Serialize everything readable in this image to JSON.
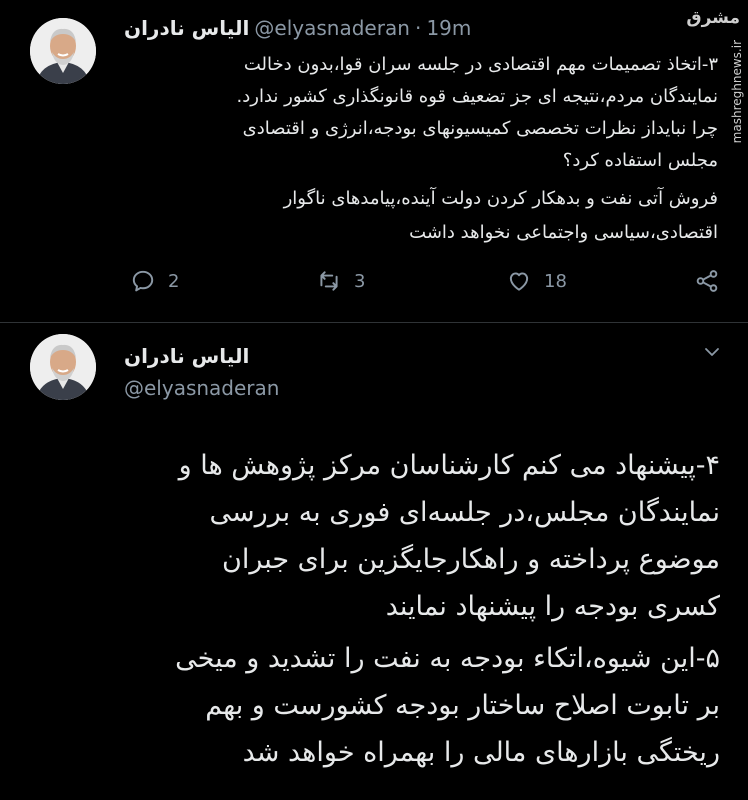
{
  "watermark": {
    "logo_text": "مشرق",
    "site": "mashreghnews.ir"
  },
  "tweet1": {
    "display_name": "الیاس نادران",
    "handle": "@elyasnaderan",
    "separator": "·",
    "time": "19m",
    "lines": [
      "۳-اتخاذ تصمیمات مهم اقتصادی در جلسه سران قوا،بدون دخالت",
      "نمایندگان مردم،نتیجه  ای جز تضعیف قوه قانونگذاری کشور ندارد.",
      "چرا نبایداز نظرات تخصصی کمیسیونهای بودجه،انرژی و اقتصادی",
      "مجلس استفاده کرد؟",
      "فروش آتی نفت و بدهکار کردن دولت آینده،پیامدهای ناگوار",
      "اقتصادی،سیاسی واجتماعی نخواهد داشت"
    ],
    "replies": "2",
    "retweets": "3",
    "likes": "18"
  },
  "tweet2": {
    "display_name": "الیاس نادران",
    "handle": "@elyasnaderan",
    "lines": [
      "۴-پیشنهاد می کنم کارشناسان مرکز پژوهش ها و",
      "نمایندگان مجلس،در جلسه‌ای فوری به بررسی",
      "موضوع پرداخته و راهکارجایگزین  برای جبران",
      "کسری بودجه را پیشنهاد نمایند",
      "۵-این شیوه،اتکاء بودجه به نفت را تشدید و میخی",
      "بر تابوت اصلاح ساختار بودجه کشورست و بهم",
      "ریختگی بازارهای مالی را بهمراه خواهد شد"
    ]
  }
}
